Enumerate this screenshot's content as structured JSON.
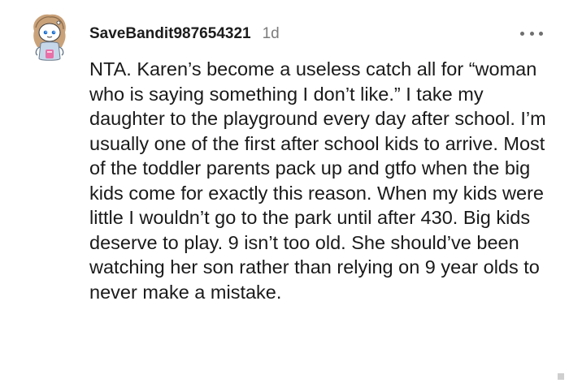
{
  "comment": {
    "username": "SaveBandit987654321",
    "timestamp": "1d",
    "more_icon": "more-horizontal-icon",
    "avatar_icon": "snoo-avatar-icon",
    "body": "NTA. Karen’s become a useless catch all for “woman who is saying something I don’t like.” I take my daughter to the playground every day after school. I’m usually one of the first after school kids to arrive. Most of the toddler parents pack up and gtfo when the big kids come for exactly this reason. When my kids were little I wouldn’t go to the park until after 430. Big kids deserve to play. 9 isn’t too old. She should’ve been watching her son rather than relying on 9 year olds to never make a mistake."
  }
}
